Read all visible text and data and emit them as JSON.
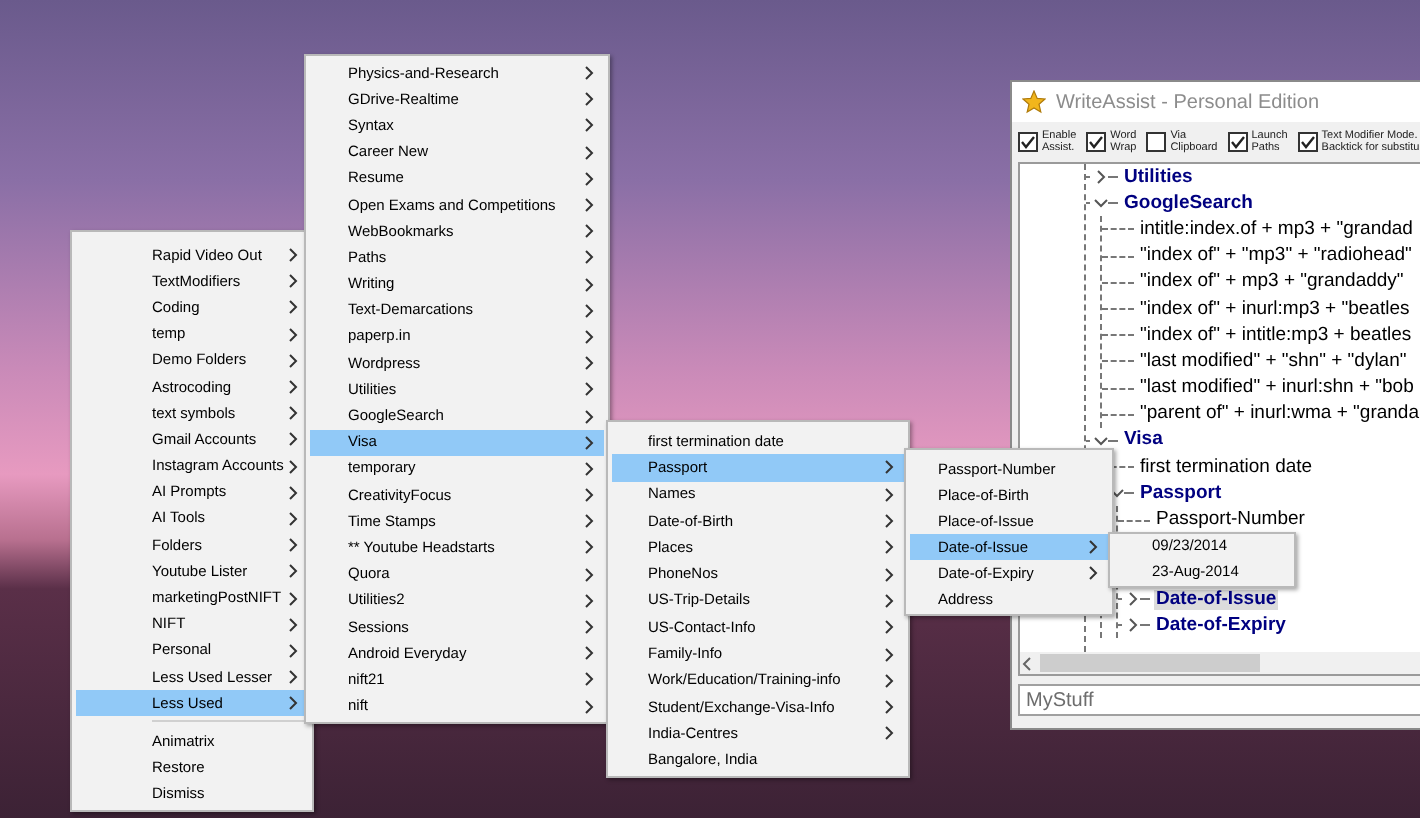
{
  "window": {
    "title": "WriteAssist - Personal Edition",
    "checkboxes": [
      {
        "label": "Enable\nAssist.",
        "checked": true
      },
      {
        "label": "Word\nWrap",
        "checked": true
      },
      {
        "label": "Via\nClipboard",
        "checked": false
      },
      {
        "label": "Launch\nPaths",
        "checked": true
      },
      {
        "label": "Text Modifier Mode.\nBacktick for substitu",
        "checked": true
      }
    ],
    "tree": [
      {
        "label": "Utilities",
        "kind": "group",
        "expanded": false,
        "selected": false
      },
      {
        "label": "GoogleSearch",
        "kind": "group",
        "expanded": true,
        "selected": false,
        "children": [
          {
            "label": "intitle:index.of + mp3 + \"grandad",
            "kind": "leaf",
            "selected": false
          },
          {
            "label": "\"index of\" + \"mp3\" + \"radiohead\"",
            "kind": "leaf",
            "selected": false
          },
          {
            "label": "\"index of\" + mp3 + \"grandaddy\"",
            "kind": "leaf",
            "selected": false
          },
          {
            "label": "\"index of\" + inurl:mp3 + \"beatles",
            "kind": "leaf",
            "selected": false
          },
          {
            "label": "\"index of\" + intitle:mp3 + beatles",
            "kind": "leaf",
            "selected": false
          },
          {
            "label": "\"last modified\" + \"shn\" + \"dylan\"",
            "kind": "leaf",
            "selected": false
          },
          {
            "label": "\"last modified\" + inurl:shn + \"bob",
            "kind": "leaf",
            "selected": false
          },
          {
            "label": "\"parent of\" + inurl:wma + \"granda",
            "kind": "leaf",
            "selected": false
          }
        ]
      },
      {
        "label": "Visa",
        "kind": "group",
        "expanded": true,
        "selected": false,
        "children": [
          {
            "label": "first termination date",
            "kind": "leaf",
            "selected": false
          },
          {
            "label": "Passport",
            "kind": "group",
            "expanded": true,
            "selected": false,
            "children": [
              {
                "label": "Passport-Number",
                "kind": "leaf",
                "selected": false
              },
              {
                "kind": "covered"
              },
              {
                "kind": "covered"
              },
              {
                "label": "Date-of-Issue",
                "kind": "group",
                "expanded": false,
                "selected": true
              },
              {
                "label": "Date-of-Expiry",
                "kind": "group",
                "expanded": false,
                "selected": false
              }
            ]
          }
        ]
      }
    ],
    "text_field": {
      "value": "MyStuff"
    }
  },
  "menus": [
    {
      "items": [
        {
          "label": "Rapid Video Out",
          "submenu": true,
          "selected": false
        },
        {
          "label": "TextModifiers",
          "submenu": true,
          "selected": false
        },
        {
          "label": "Coding",
          "submenu": true,
          "selected": false
        },
        {
          "label": "temp",
          "submenu": true,
          "selected": false
        },
        {
          "label": "Demo Folders",
          "submenu": true,
          "selected": false
        },
        {
          "label": "Astrocoding",
          "submenu": true,
          "selected": false
        },
        {
          "label": "text symbols",
          "submenu": true,
          "selected": false
        },
        {
          "label": "Gmail Accounts",
          "submenu": true,
          "selected": false
        },
        {
          "label": "Instagram Accounts",
          "submenu": true,
          "selected": false
        },
        {
          "label": "AI Prompts",
          "submenu": true,
          "selected": false
        },
        {
          "label": "AI Tools",
          "submenu": true,
          "selected": false
        },
        {
          "label": "Folders",
          "submenu": true,
          "selected": false
        },
        {
          "label": "Youtube Lister",
          "submenu": true,
          "selected": false
        },
        {
          "label": "marketingPostNIFT",
          "submenu": true,
          "selected": false
        },
        {
          "label": "NIFT",
          "submenu": true,
          "selected": false
        },
        {
          "label": "Personal",
          "submenu": true,
          "selected": false
        },
        {
          "label": "Less Used Lesser",
          "submenu": true,
          "selected": false
        },
        {
          "label": "Less Used",
          "submenu": true,
          "selected": true
        }
      ],
      "footer_items": [
        {
          "label": "Animatrix",
          "submenu": false,
          "selected": false
        },
        {
          "label": "Restore",
          "submenu": false,
          "selected": false
        },
        {
          "label": "Dismiss",
          "submenu": false,
          "selected": false
        }
      ]
    },
    {
      "items": [
        {
          "label": "Physics-and-Research",
          "submenu": true,
          "selected": false
        },
        {
          "label": "GDrive-Realtime",
          "submenu": true,
          "selected": false
        },
        {
          "label": "Syntax",
          "submenu": true,
          "selected": false
        },
        {
          "label": "Career New",
          "submenu": true,
          "selected": false
        },
        {
          "label": "Resume",
          "submenu": true,
          "selected": false
        },
        {
          "label": "Open Exams and Competitions",
          "submenu": true,
          "selected": false
        },
        {
          "label": "WebBookmarks",
          "submenu": true,
          "selected": false
        },
        {
          "label": "Paths",
          "submenu": true,
          "selected": false
        },
        {
          "label": "Writing",
          "submenu": true,
          "selected": false
        },
        {
          "label": "Text-Demarcations",
          "submenu": true,
          "selected": false
        },
        {
          "label": "paperp.in",
          "submenu": true,
          "selected": false
        },
        {
          "label": "Wordpress",
          "submenu": true,
          "selected": false
        },
        {
          "label": "Utilities",
          "submenu": true,
          "selected": false
        },
        {
          "label": "GoogleSearch",
          "submenu": true,
          "selected": false
        },
        {
          "label": "Visa",
          "submenu": true,
          "selected": true
        },
        {
          "label": "temporary",
          "submenu": true,
          "selected": false
        },
        {
          "label": "CreativityFocus",
          "submenu": true,
          "selected": false
        },
        {
          "label": "Time Stamps",
          "submenu": true,
          "selected": false
        },
        {
          "label": "** Youtube Headstarts",
          "submenu": true,
          "selected": false
        },
        {
          "label": "Quora",
          "submenu": true,
          "selected": false
        },
        {
          "label": "Utilities2",
          "submenu": true,
          "selected": false
        },
        {
          "label": "Sessions",
          "submenu": true,
          "selected": false
        },
        {
          "label": "Android Everyday",
          "submenu": true,
          "selected": false
        },
        {
          "label": "nift21",
          "submenu": true,
          "selected": false
        },
        {
          "label": "nift",
          "submenu": true,
          "selected": false
        }
      ]
    },
    {
      "items": [
        {
          "label": "first termination date",
          "submenu": false,
          "selected": false
        },
        {
          "label": "Passport",
          "submenu": true,
          "selected": true
        },
        {
          "label": "Names",
          "submenu": true,
          "selected": false
        },
        {
          "label": "Date-of-Birth",
          "submenu": true,
          "selected": false
        },
        {
          "label": "Places",
          "submenu": true,
          "selected": false
        },
        {
          "label": "PhoneNos",
          "submenu": true,
          "selected": false
        },
        {
          "label": "US-Trip-Details",
          "submenu": true,
          "selected": false
        },
        {
          "label": "US-Contact-Info",
          "submenu": true,
          "selected": false
        },
        {
          "label": "Family-Info",
          "submenu": true,
          "selected": false
        },
        {
          "label": "Work/Education/Training-info",
          "submenu": true,
          "selected": false
        },
        {
          "label": "Student/Exchange-Visa-Info",
          "submenu": true,
          "selected": false
        },
        {
          "label": "India-Centres",
          "submenu": true,
          "selected": false
        },
        {
          "label": "Bangalore, India",
          "submenu": false,
          "selected": false
        }
      ]
    },
    {
      "items": [
        {
          "label": "Passport-Number",
          "submenu": false,
          "selected": false
        },
        {
          "label": "Place-of-Birth",
          "submenu": false,
          "selected": false
        },
        {
          "label": "Place-of-Issue",
          "submenu": false,
          "selected": false
        },
        {
          "label": "Date-of-Issue",
          "submenu": true,
          "selected": true
        },
        {
          "label": "Date-of-Expiry",
          "submenu": true,
          "selected": false
        },
        {
          "label": "Address",
          "submenu": false,
          "selected": false
        }
      ]
    },
    {
      "items": [
        {
          "label": "09/23/2014",
          "submenu": false,
          "selected": false
        },
        {
          "label": "23-Aug-2014",
          "submenu": false,
          "selected": false
        }
      ]
    }
  ]
}
